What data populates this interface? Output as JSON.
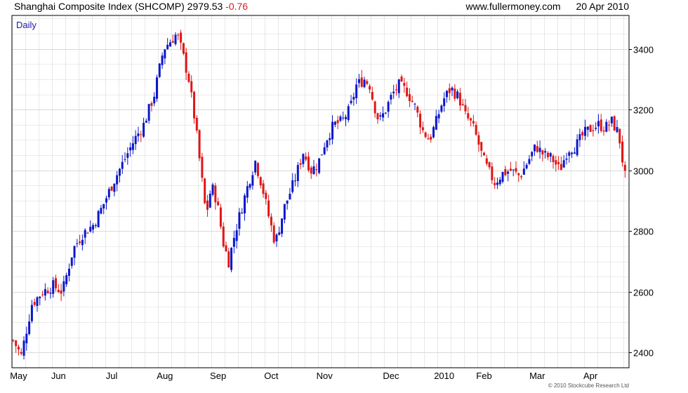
{
  "header": {
    "title": "Shanghai Composite Index (SHCOMP)",
    "last": "2979.53",
    "change": "-0.76",
    "site": "www.fullermoney.com",
    "date": "20 Apr 2010"
  },
  "panel_label": "Daily",
  "footer": "© 2010 Stockcube Research Ltd",
  "colors": {
    "up": "#0b17c9",
    "down": "#e01616",
    "grid": "#d9d9d9",
    "frame": "#000000"
  },
  "chart_data": {
    "type": "candlestick",
    "title": "Shanghai Composite Index (SHCOMP)",
    "ylim": [
      2350,
      3510
    ],
    "yticks": [
      2400,
      2600,
      2800,
      3000,
      3200,
      3400
    ],
    "x_labels": [
      "May",
      "Jun",
      "Jul",
      "Aug",
      "Sep",
      "Oct",
      "Nov",
      "Dec",
      "2010",
      "Feb",
      "Mar",
      "Apr"
    ],
    "label_pos": [
      0.5,
      3.5,
      7.5,
      11.5,
      15.5,
      19.5,
      23.5,
      28.5,
      32.5,
      35.5,
      39.5,
      43.5
    ],
    "x_range": [
      0,
      46.4
    ],
    "series": [
      {
        "values": [
          [
            0.1,
            2440
          ],
          [
            0.7,
            2390
          ],
          [
            1.5,
            2560
          ],
          [
            2.3,
            2600
          ],
          [
            3.1,
            2620
          ],
          [
            3.8,
            2600
          ],
          [
            4.6,
            2740
          ],
          [
            5.3,
            2790
          ],
          [
            6.1,
            2820
          ],
          [
            6.8,
            2880
          ],
          [
            7.6,
            2960
          ],
          [
            8.4,
            3030
          ],
          [
            9.2,
            3100
          ],
          [
            9.9,
            3150
          ],
          [
            10.7,
            3250
          ],
          [
            11.4,
            3400
          ],
          [
            12.0,
            3430
          ],
          [
            12.4,
            3450
          ],
          [
            12.8,
            3390
          ],
          [
            13.3,
            3300
          ],
          [
            13.8,
            3150
          ],
          [
            14.2,
            3000
          ],
          [
            14.6,
            2850
          ],
          [
            15.0,
            2950
          ],
          [
            15.4,
            2900
          ],
          [
            15.9,
            2760
          ],
          [
            16.3,
            2700
          ],
          [
            16.8,
            2800
          ],
          [
            17.3,
            2880
          ],
          [
            17.8,
            2960
          ],
          [
            18.3,
            3030
          ],
          [
            18.8,
            2950
          ],
          [
            19.3,
            2850
          ],
          [
            19.8,
            2760
          ],
          [
            20.5,
            2880
          ],
          [
            21.2,
            2960
          ],
          [
            21.9,
            3060
          ],
          [
            22.5,
            3000
          ],
          [
            23.0,
            3020
          ],
          [
            23.6,
            3100
          ],
          [
            24.2,
            3150
          ],
          [
            24.8,
            3160
          ],
          [
            25.4,
            3200
          ],
          [
            25.9,
            3280
          ],
          [
            26.5,
            3300
          ],
          [
            26.9,
            3280
          ],
          [
            27.2,
            3220
          ],
          [
            27.6,
            3160
          ],
          [
            28.0,
            3190
          ],
          [
            28.6,
            3250
          ],
          [
            29.1,
            3280
          ],
          [
            29.7,
            3260
          ],
          [
            30.3,
            3210
          ],
          [
            30.9,
            3130
          ],
          [
            31.4,
            3100
          ],
          [
            31.9,
            3160
          ],
          [
            32.4,
            3230
          ],
          [
            33.0,
            3270
          ],
          [
            33.6,
            3240
          ],
          [
            34.1,
            3180
          ],
          [
            34.6,
            3150
          ],
          [
            35.0,
            3100
          ],
          [
            35.4,
            3040
          ],
          [
            35.8,
            3000
          ],
          [
            36.3,
            2960
          ],
          [
            36.9,
            2990
          ],
          [
            37.5,
            3000
          ],
          [
            38.2,
            2980
          ],
          [
            38.8,
            3030
          ],
          [
            39.4,
            3080
          ],
          [
            40.0,
            3050
          ],
          [
            40.6,
            3040
          ],
          [
            41.2,
            3000
          ],
          [
            41.8,
            3070
          ],
          [
            42.4,
            3080
          ],
          [
            43.0,
            3120
          ],
          [
            43.6,
            3140
          ],
          [
            44.1,
            3150
          ],
          [
            44.6,
            3140
          ],
          [
            45.1,
            3160
          ],
          [
            45.5,
            3130
          ],
          [
            45.8,
            3080
          ],
          [
            46.0,
            2990
          ],
          [
            46.1,
            2980
          ]
        ]
      }
    ]
  }
}
